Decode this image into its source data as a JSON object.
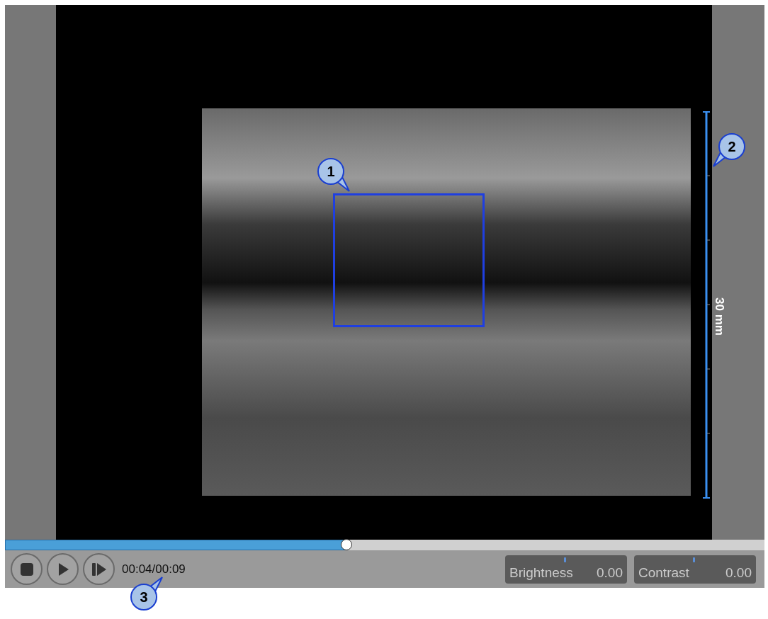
{
  "player": {
    "scale_label": "30 mm",
    "progress": {
      "level": 0.45
    },
    "buttons": [
      {
        "kind": "stop"
      },
      {
        "kind": "play"
      },
      {
        "kind": "step"
      }
    ],
    "time": "00:04/00:09",
    "adjustments": [
      {
        "label": "Brightness",
        "value": "0.00",
        "level": 0.49
      },
      {
        "label": "Contrast",
        "value": "0.00",
        "level": 0.49
      }
    ]
  },
  "callouts": [
    "1",
    "2",
    "3"
  ]
}
